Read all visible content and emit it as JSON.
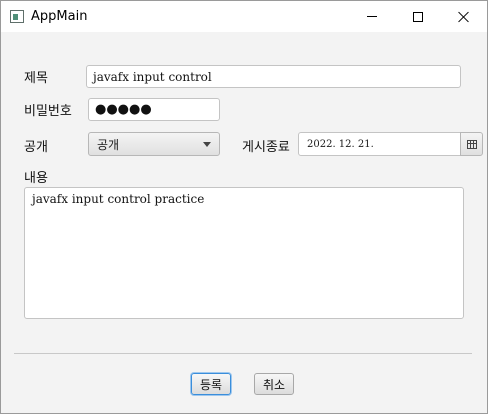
{
  "window": {
    "title": "AppMain",
    "controls": [
      "minimize",
      "maximize",
      "close"
    ]
  },
  "form": {
    "title_label": "제목",
    "title_value": "javafx input control",
    "password_label": "비밀번호",
    "password_value": "●●●●●",
    "visibility_label": "공개",
    "visibility_selected": "공개",
    "end_date_label": "게시종료",
    "end_date_value": "2022. 12. 21.",
    "content_label": "내용",
    "content_value": "javafx input control practice"
  },
  "buttons": {
    "register": "등록",
    "cancel": "취소"
  },
  "icons": {
    "app": "app-window-icon",
    "date": "calendar-icon",
    "combo": "chevron-down-icon"
  },
  "colors": {
    "focus_accent": "#3a8edb",
    "background": "#f3f3f3"
  }
}
